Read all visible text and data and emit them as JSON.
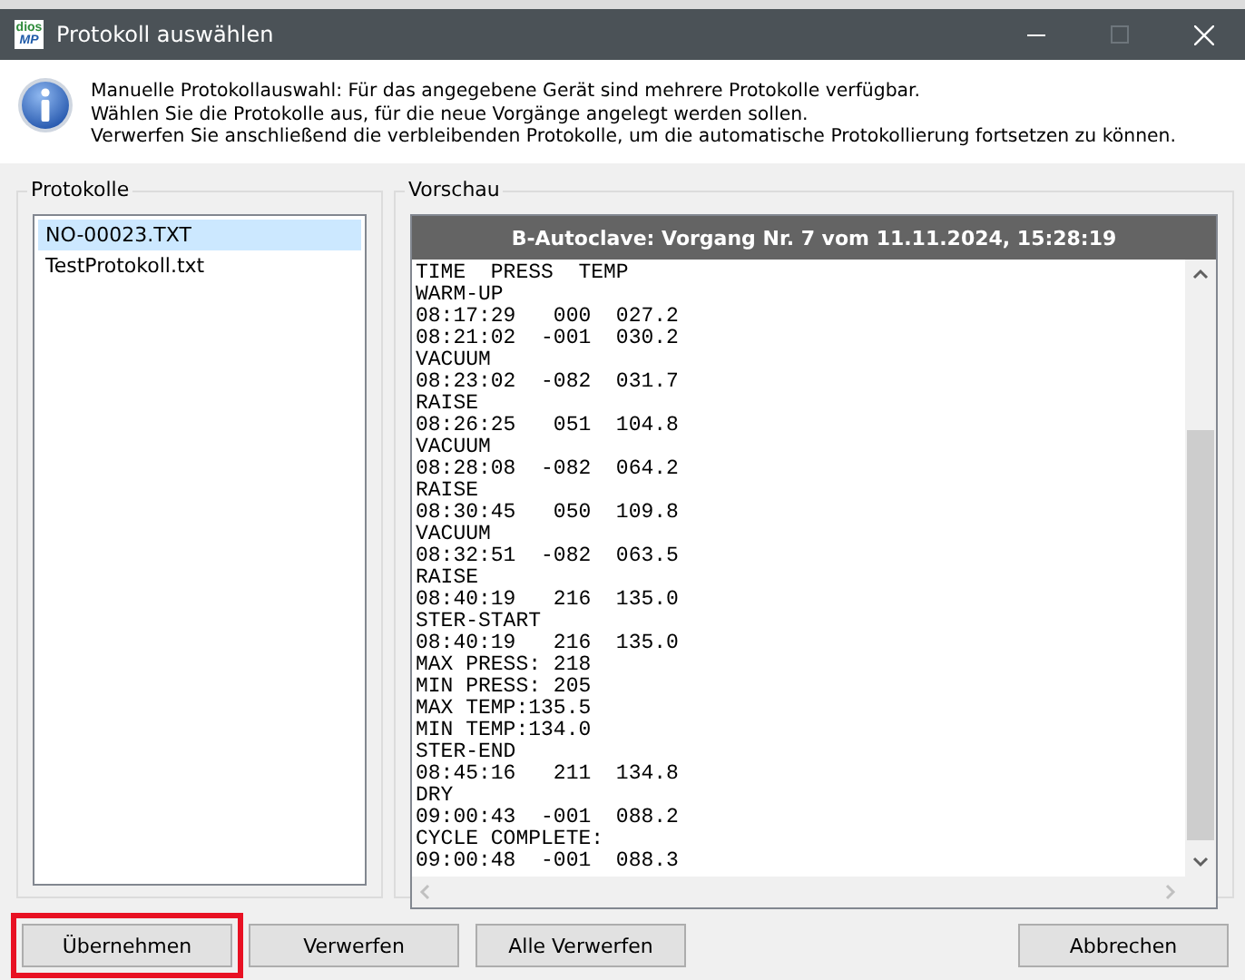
{
  "window": {
    "title": "Protokoll auswählen",
    "logo": {
      "top": "dios",
      "bottom": "MP"
    },
    "window_buttons": [
      {
        "kind": "minimize",
        "disabled": false
      },
      {
        "kind": "maximize",
        "disabled": true
      },
      {
        "kind": "close",
        "disabled": false
      }
    ]
  },
  "message": {
    "lines": [
      "Manuelle Protokollauswahl: Für das angegebene Gerät sind mehrere Protokolle verfügbar.",
      "Wählen Sie die Protokolle aus, für die neue Vorgänge angelegt werden sollen.",
      "Verwerfen Sie anschließend die verbleibenden Protokolle, um die automatische Protokollierung fortsetzen zu können."
    ]
  },
  "protocols": {
    "label": "Protokolle",
    "items": [
      {
        "name": "NO-00023.TXT",
        "selected": true
      },
      {
        "name": "TestProtokoll.txt",
        "selected": false
      }
    ]
  },
  "preview": {
    "label": "Vorschau",
    "header": "B-Autoclave: Vorgang Nr. 7 vom 11.11.2024, 15:28:19",
    "lines": [
      "TIME  PRESS  TEMP",
      "WARM-UP",
      "08:17:29   000  027.2",
      "08:21:02  -001  030.2",
      "VACUUM",
      "08:23:02  -082  031.7",
      "RAISE",
      "08:26:25   051  104.8",
      "VACUUM",
      "08:28:08  -082  064.2",
      "RAISE",
      "08:30:45   050  109.8",
      "VACUUM",
      "08:32:51  -082  063.5",
      "RAISE",
      "08:40:19   216  135.0",
      "STER-START",
      "08:40:19   216  135.0",
      "MAX PRESS: 218",
      "MIN PRESS: 205",
      "MAX TEMP:135.5",
      "MIN TEMP:134.0",
      "STER-END",
      "08:45:16   211  134.8",
      "DRY",
      "09:00:43  -001  088.2",
      "CYCLE COMPLETE:",
      "09:00:48  -001  088.3"
    ]
  },
  "buttons": [
    {
      "label": "Übernehmen",
      "kind": "action",
      "highlighted": true
    },
    {
      "label": "Verwerfen",
      "kind": "action",
      "highlighted": false
    },
    {
      "label": "Alle Verwerfen",
      "kind": "action",
      "highlighted": false
    },
    {
      "label": "Abbrechen",
      "kind": "cancel",
      "highlighted": false
    }
  ]
}
